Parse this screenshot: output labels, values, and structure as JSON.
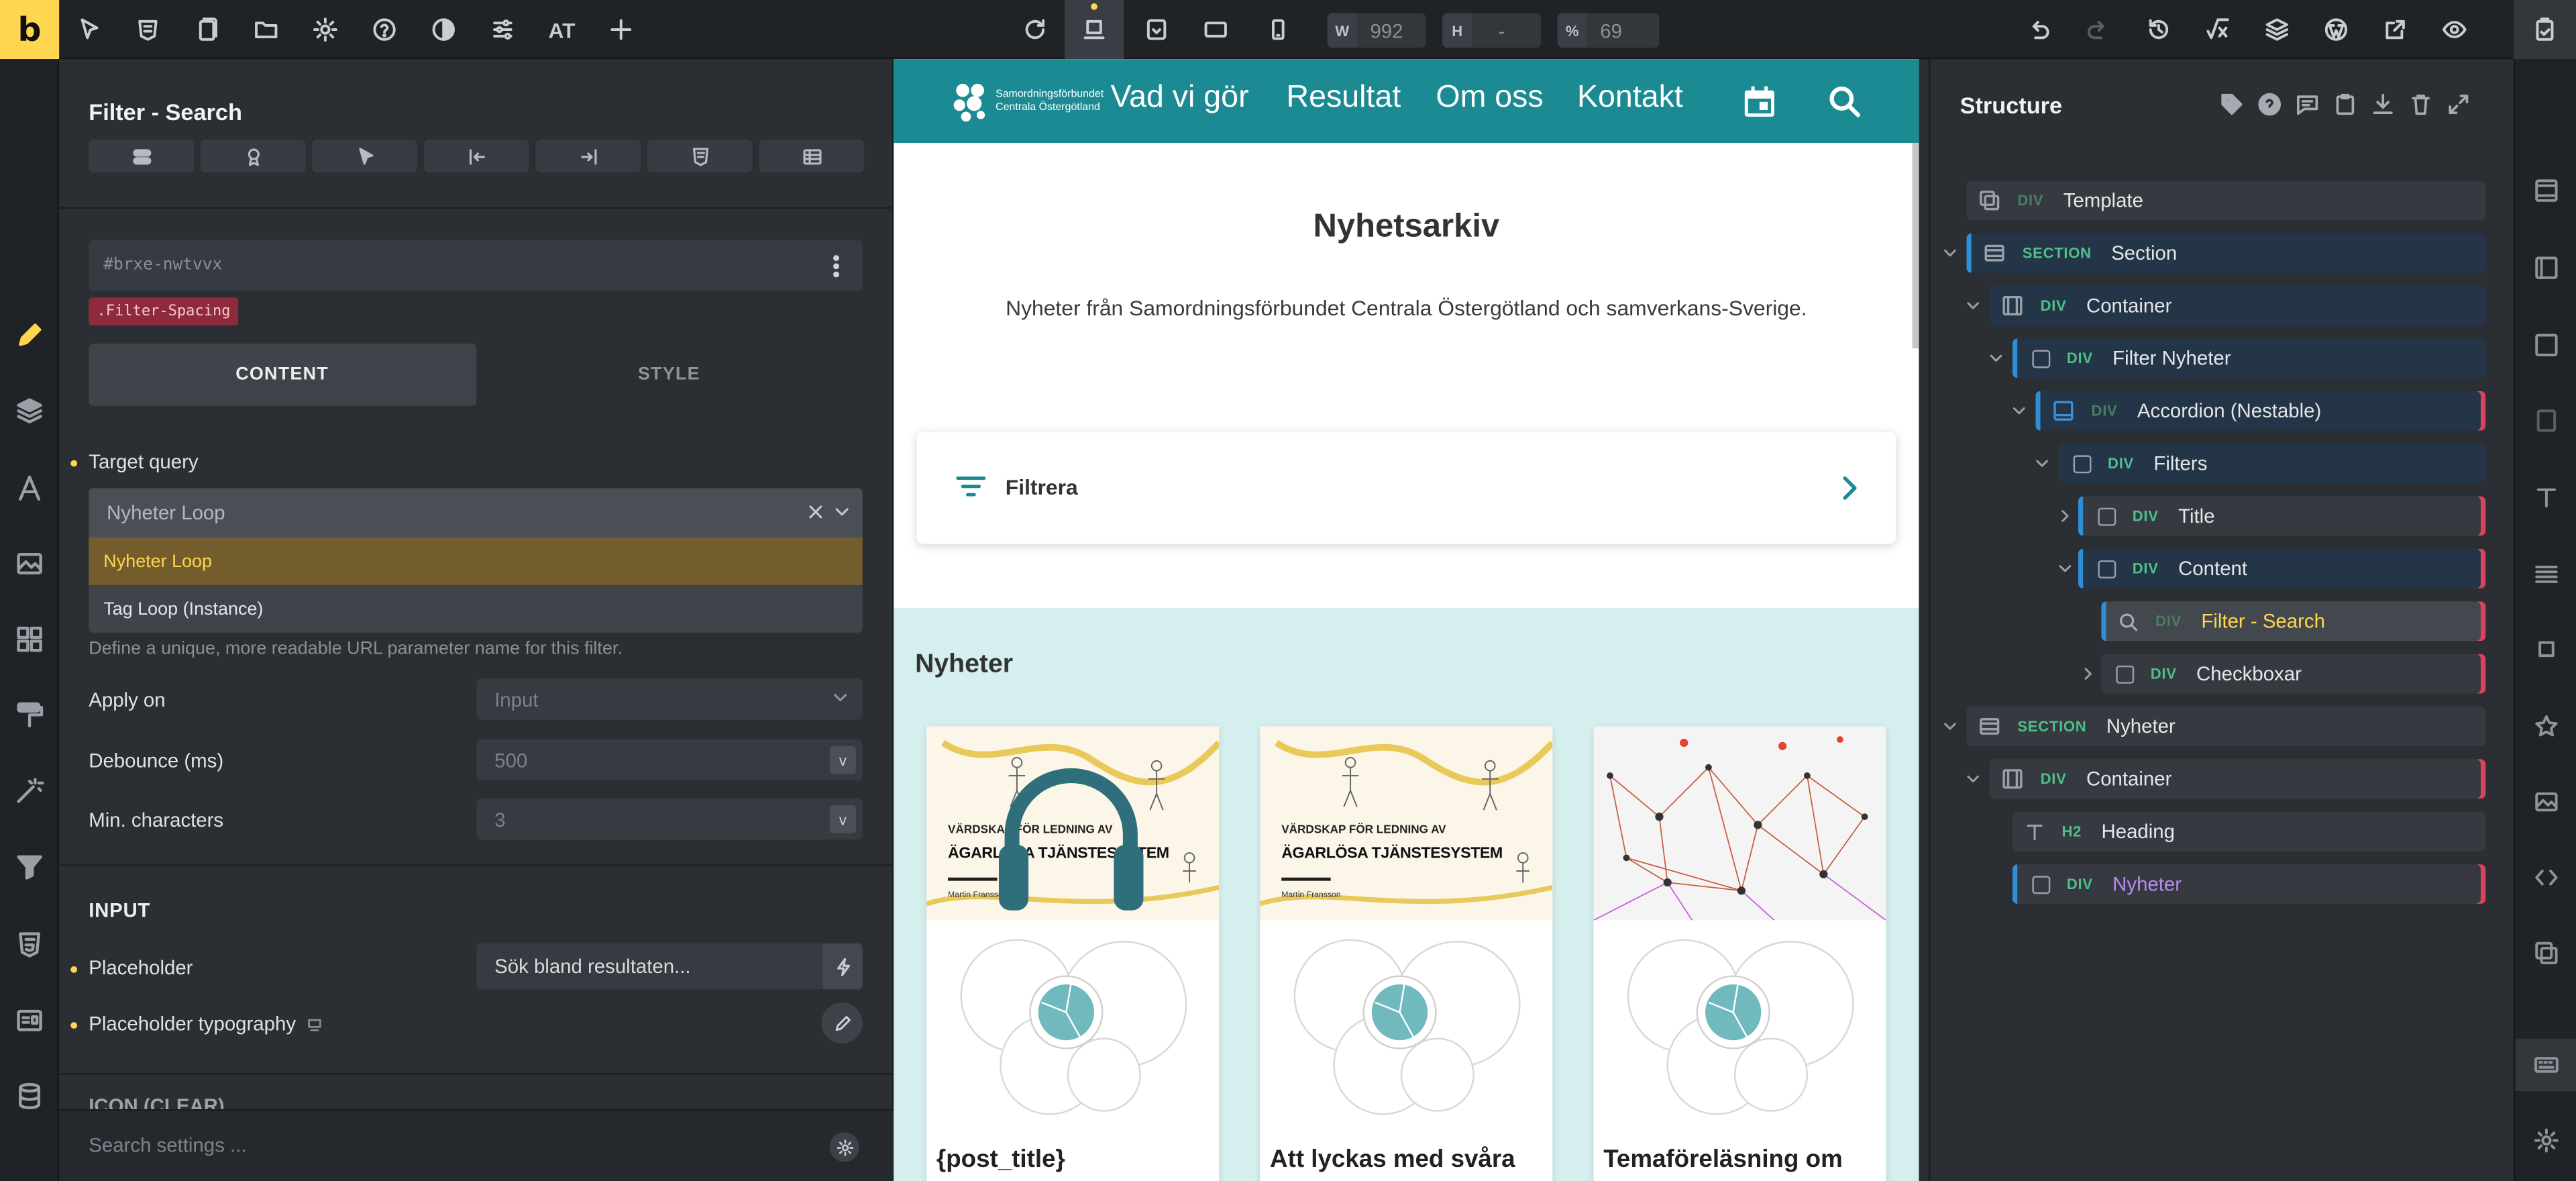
{
  "topbar": {
    "logo": "b",
    "custom_text_button": "AT",
    "width_label": "W",
    "width_value": "992",
    "height_label": "H",
    "height_value": "-",
    "percent_label": "%",
    "percent_value": "69"
  },
  "panel": {
    "title": "Filter - Search",
    "element_id": "#brxe-nwtvvx",
    "class_name": ".Filter-Spacing",
    "tab_content": "CONTENT",
    "tab_style": "STYLE",
    "target_query_label": "Target query",
    "target_query_value": "Nyheter Loop",
    "dropdown_options": [
      "Nyheter Loop",
      "Tag Loop (Instance)"
    ],
    "hint": "Define a unique, more readable URL parameter name for this filter.",
    "apply_on_label": "Apply on",
    "apply_on_value": "Input",
    "debounce_label": "Debounce (ms)",
    "debounce_value": "500",
    "min_chars_label": "Min. characters",
    "min_chars_value": "3",
    "unit_v": "v",
    "input_section": "INPUT",
    "placeholder_label": "Placeholder",
    "placeholder_value": "Sök bland resultaten...",
    "placeholder_typo_label": "Placeholder typography",
    "clipped_section": "ICON (CLEAR)",
    "search_settings_placeholder": "Search settings ..."
  },
  "site": {
    "logo_line1": "Samordningsförbundet",
    "logo_line2": "Centrala Östergötland",
    "nav": [
      "Vad vi gör",
      "Resultat",
      "Om oss",
      "Kontakt"
    ],
    "heading": "Nyhetsarkiv",
    "lead": "Nyheter från Samordningsförbundet Centrala Östergötland och samverkans-Sverige.",
    "filter_label": "Filtrera",
    "news_heading": "Nyheter",
    "book_small": "VÄRDSKAP FÖR LEDNING AV",
    "book_big": "ÄGARLÖSA TJÄNSTESYSTEM",
    "book_author": "Martin Fransson",
    "cards": [
      "{post_title}",
      "Att lyckas med svåra",
      "Temaföreläsning om"
    ]
  },
  "structure": {
    "title": "Structure",
    "rows": [
      {
        "tag": "DIV",
        "name": "Template"
      },
      {
        "tag": "SECTION",
        "name": "Section"
      },
      {
        "tag": "DIV",
        "name": "Container"
      },
      {
        "tag": "DIV",
        "name": "Filter Nyheter"
      },
      {
        "tag": "DIV",
        "name": "Accordion (Nestable)"
      },
      {
        "tag": "DIV",
        "name": "Filters"
      },
      {
        "tag": "DIV",
        "name": "Title"
      },
      {
        "tag": "DIV",
        "name": "Content"
      },
      {
        "tag": "DIV",
        "name": "Filter - Search"
      },
      {
        "tag": "DIV",
        "name": "Checkboxar"
      },
      {
        "tag": "SECTION",
        "name": "Nyheter"
      },
      {
        "tag": "DIV",
        "name": "Container"
      },
      {
        "tag": "H2",
        "name": "Heading"
      },
      {
        "tag": "DIV",
        "name": "Nyheter"
      }
    ]
  },
  "colors": {
    "brand_yellow": "#ffd64f",
    "site_teal": "#1b8a93",
    "news_band": "#d5eeee",
    "tag_green": "#4cc18a",
    "accent_pink": "#d9435f",
    "accent_blue": "#2f8ed8"
  }
}
